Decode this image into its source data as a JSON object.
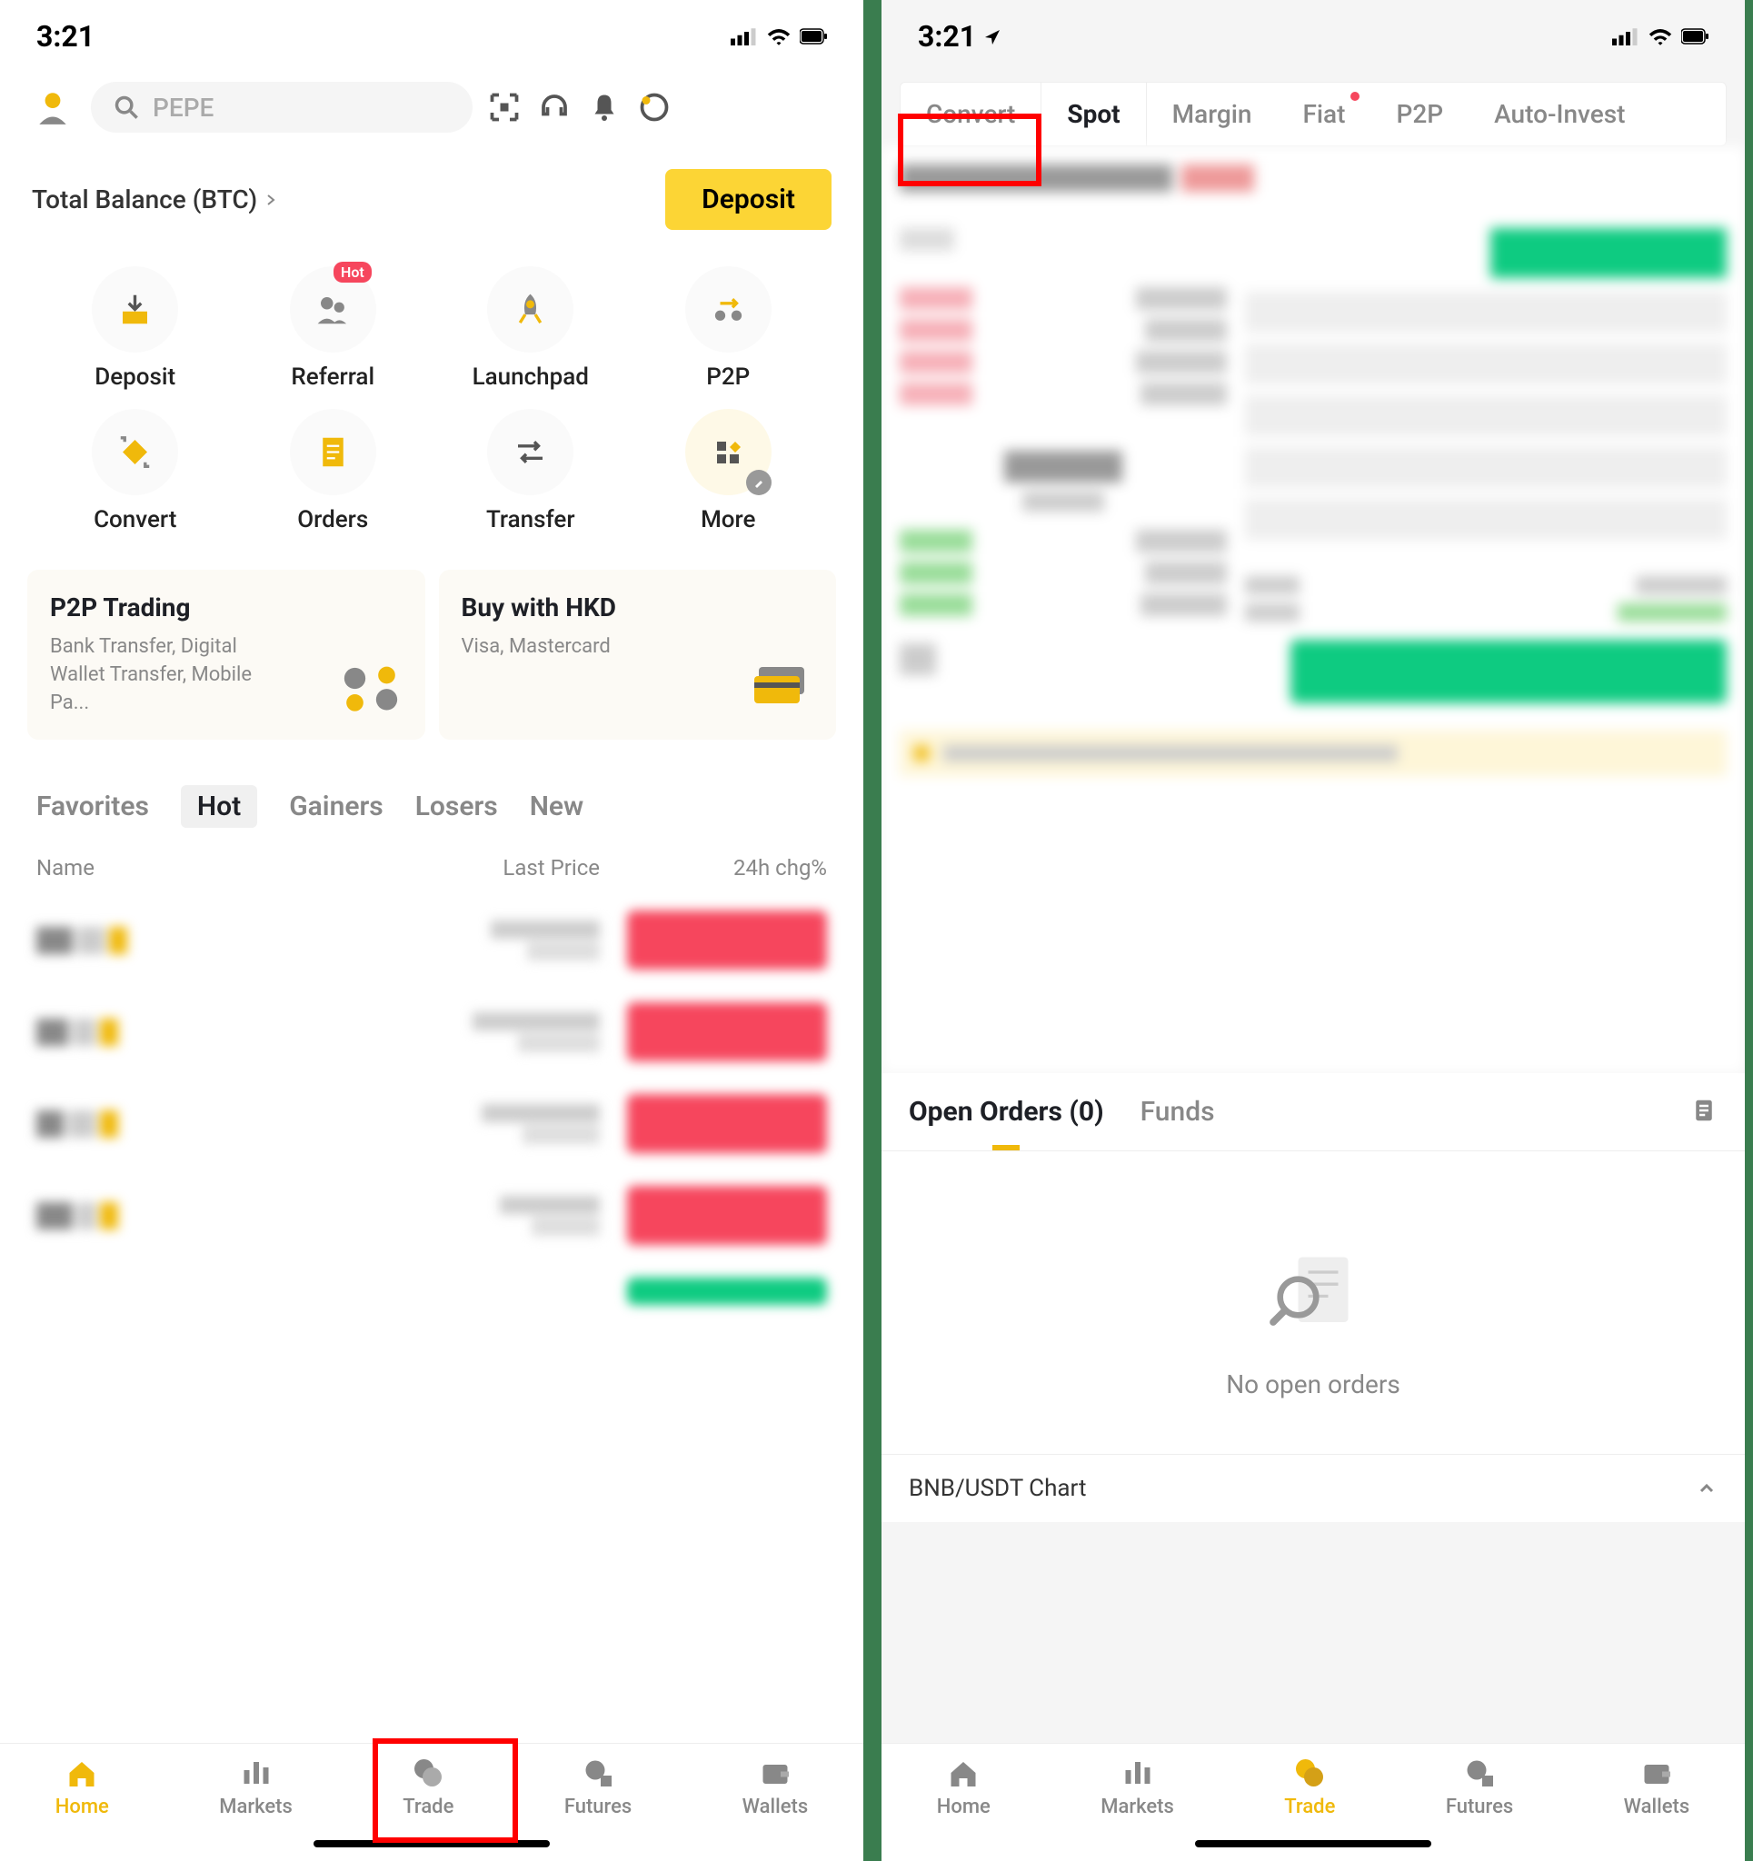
{
  "status": {
    "time": "3:21"
  },
  "left": {
    "search_placeholder": "PEPE",
    "balance_label": "Total Balance (BTC)",
    "deposit_btn": "Deposit",
    "actions": {
      "deposit": "Deposit",
      "referral": "Referral",
      "referral_badge": "Hot",
      "launchpad": "Launchpad",
      "p2p": "P2P",
      "convert": "Convert",
      "orders": "Orders",
      "transfer": "Transfer",
      "more": "More"
    },
    "cards": {
      "p2p_title": "P2P Trading",
      "p2p_desc": "Bank Transfer, Digital Wallet Transfer, Mobile Pa...",
      "buy_title": "Buy with HKD",
      "buy_desc": "Visa, Mastercard"
    },
    "market_tabs": {
      "favorites": "Favorites",
      "hot": "Hot",
      "gainers": "Gainers",
      "losers": "Losers",
      "new": "New"
    },
    "table_header": {
      "name": "Name",
      "price": "Last Price",
      "chg": "24h chg%"
    },
    "nav": {
      "home": "Home",
      "markets": "Markets",
      "trade": "Trade",
      "futures": "Futures",
      "wallets": "Wallets"
    }
  },
  "right": {
    "trade_tabs": {
      "convert": "Convert",
      "spot": "Spot",
      "margin": "Margin",
      "fiat": "Fiat",
      "p2p": "P2P",
      "auto": "Auto-Invest"
    },
    "orders_tab": "Open Orders (0)",
    "funds_tab": "Funds",
    "empty": "No open orders",
    "chart_label": "BNB/USDT Chart",
    "nav": {
      "home": "Home",
      "markets": "Markets",
      "trade": "Trade",
      "futures": "Futures",
      "wallets": "Wallets"
    }
  }
}
